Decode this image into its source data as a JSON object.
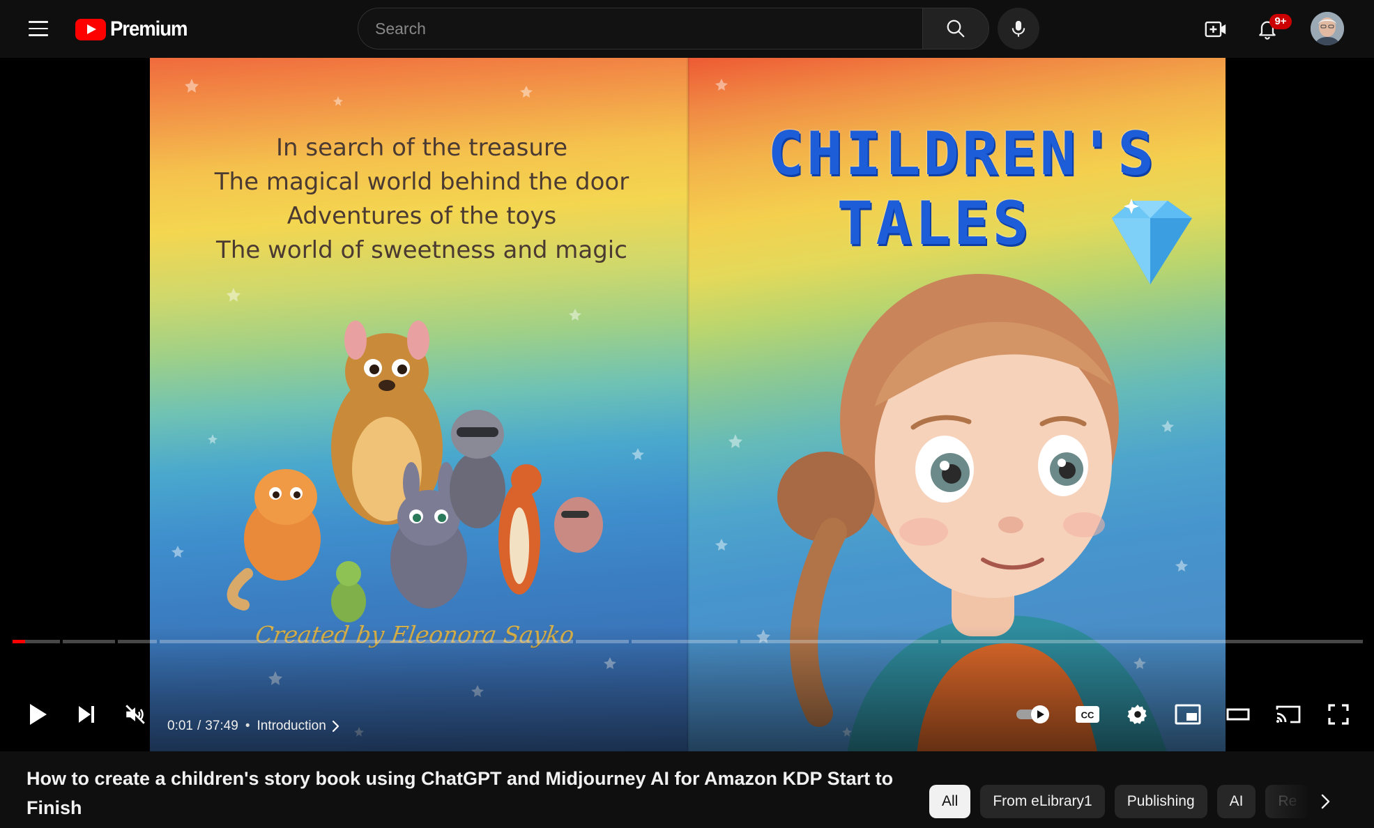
{
  "masthead": {
    "logo_text": "Premium",
    "search_placeholder": "Search",
    "notifications_badge": "9+"
  },
  "video_frame": {
    "tale_list": [
      "In search of the treasure",
      "The magical world behind the door",
      "Adventures of the toys",
      "The world of sweetness and magic"
    ],
    "credit": "Created by Eleonora Sayko",
    "book_title_line1": "CHILDREN'S",
    "book_title_line2": "TALES"
  },
  "player": {
    "current_time": "0:01",
    "time_separator": "/",
    "duration": "37:49",
    "chapter_separator": "•",
    "chapter": "Introduction",
    "progress_fraction": 0.0004,
    "autoplay": "on",
    "muted": true
  },
  "video_title": "How to create a children's story book using ChatGPT and Midjourney AI for Amazon KDP Start to Finish",
  "chips": [
    {
      "label": "All",
      "active": true
    },
    {
      "label": "From eLibrary1",
      "active": false
    },
    {
      "label": "Publishing",
      "active": false
    },
    {
      "label": "AI",
      "active": false
    },
    {
      "label": "Re",
      "active": false
    }
  ],
  "colors": {
    "background": "#0f0f0f",
    "progress_played": "#ff0000",
    "badge": "#cc0000",
    "title_blue": "#1d5ed8"
  }
}
